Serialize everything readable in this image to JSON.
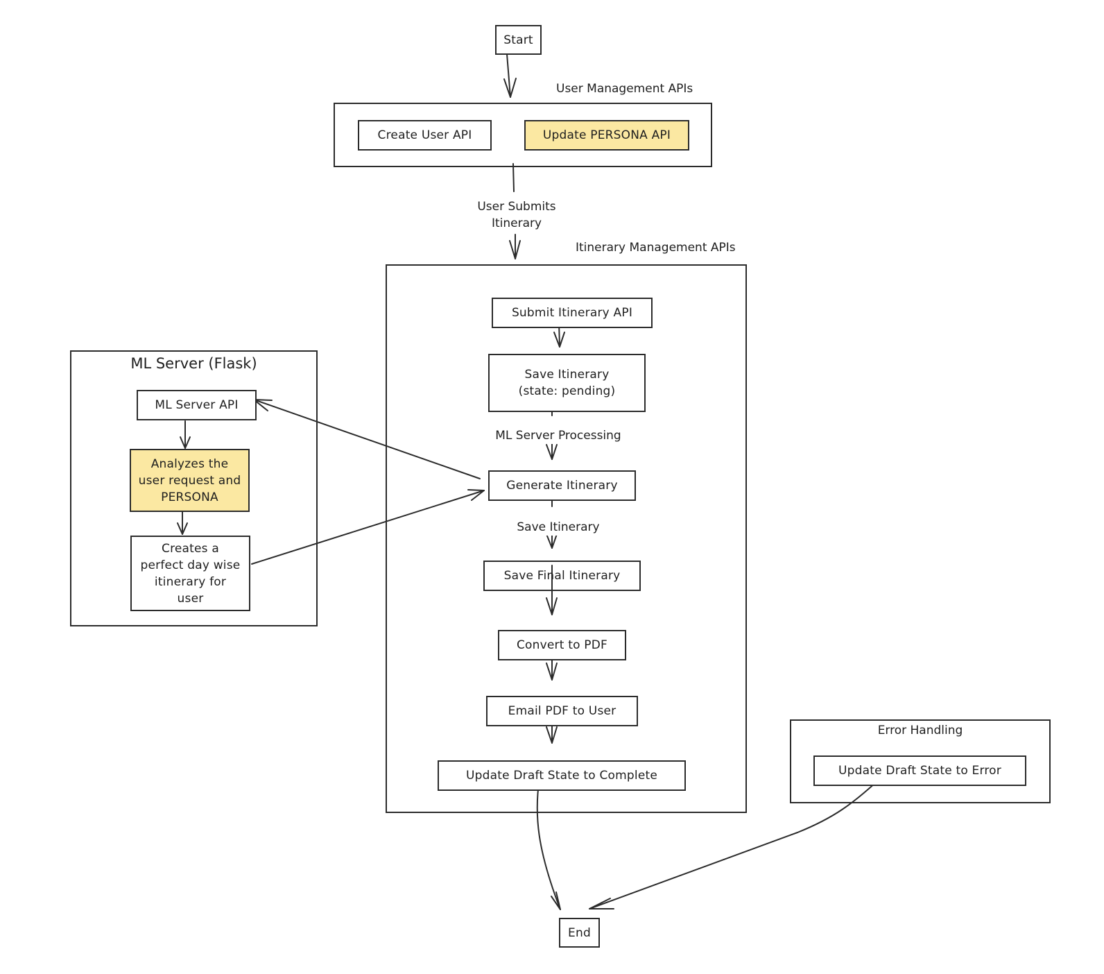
{
  "diagram": {
    "colors": {
      "stroke": "#2b2b2b",
      "highlight": "#fbe8a2",
      "background": "#ffffff"
    },
    "start": "Start",
    "end": "End",
    "user_management": {
      "title": "User Management APIs",
      "create_user": "Create User API",
      "update_persona": "Update PERSONA API"
    },
    "edge_user_submits": "User Submits\nItinerary",
    "itinerary_management": {
      "title": "Itinerary Management APIs",
      "submit": "Submit Itinerary API",
      "save_pending": "Save Itinerary\n(state: pending)",
      "edge_ml_processing": "ML Server Processing",
      "generate": "Generate Itinerary",
      "edge_save_itinerary": "Save Itinerary",
      "save_final": "Save Final Itinerary",
      "convert_pdf": "Convert to PDF",
      "email_pdf": "Email PDF to User",
      "update_complete": "Update Draft State to Complete"
    },
    "ml_server": {
      "title": "ML Server (Flask)",
      "api": "ML Server API",
      "analyze": "Analyzes the\nuser request and\nPERSONA",
      "creates": "Creates a\nperfect day wise\nitinerary for\nuser"
    },
    "error_handling": {
      "title": "Error Handling",
      "update_error": "Update Draft State to Error"
    }
  }
}
